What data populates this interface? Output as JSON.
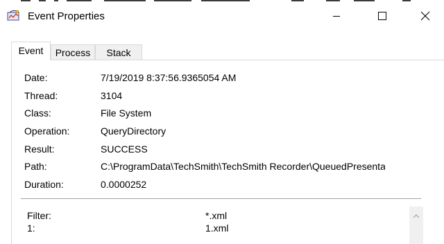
{
  "window": {
    "title": "Event Properties",
    "controls": {
      "minimize": "minimize",
      "maximize": "maximize",
      "close": "close"
    }
  },
  "tabs": [
    {
      "label": "Event",
      "active": true
    },
    {
      "label": "Process",
      "active": false
    },
    {
      "label": "Stack",
      "active": false
    }
  ],
  "properties": {
    "date": {
      "label": "Date:",
      "value": "7/19/2019 8:37:56.9365054 AM"
    },
    "thread": {
      "label": "Thread:",
      "value": "3104"
    },
    "class": {
      "label": "Class:",
      "value": "File System"
    },
    "operation": {
      "label": "Operation:",
      "value": "QueryDirectory"
    },
    "result": {
      "label": "Result:",
      "value": "SUCCESS"
    },
    "path": {
      "label": "Path:",
      "value": "C:\\ProgramData\\TechSmith\\TechSmith Recorder\\QueuedPresentations"
    },
    "duration": {
      "label": "Duration:",
      "value": "0.0000252"
    }
  },
  "details": [
    {
      "label": "Filter:",
      "value": "*.xml"
    },
    {
      "label": "1:",
      "value": "1.xml"
    }
  ],
  "icons": {
    "app": "process-monitor-icon",
    "scroll_up": "chevron-up-icon"
  },
  "colors": {
    "border": "#d9d9d9",
    "tab_inactive_bg": "#f0f0f0",
    "divider": "#a0a0a0",
    "scrollbar_bg": "#f0f0f0"
  }
}
